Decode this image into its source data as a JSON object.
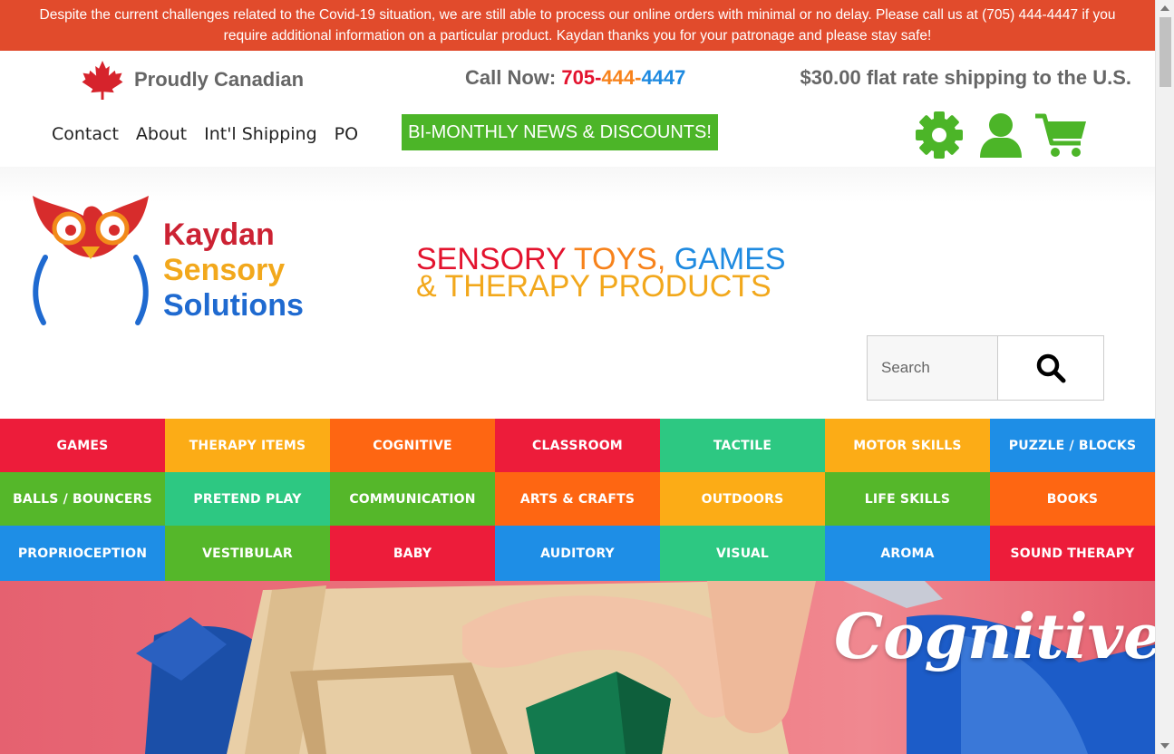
{
  "banner": {
    "line1": "Despite the current challenges related to the Covid-19 situation, we are still able to process our online orders with minimal or no delay. Please call us at (705) 444-4447 if you",
    "line2": "require additional information on a particular product. Kaydan thanks you for your patronage and please stay safe!"
  },
  "topbar": {
    "proudly_canadian": "Proudly Canadian",
    "call_label": "Call Now: ",
    "phone_part1": "705",
    "phone_sep1": "-",
    "phone_part2": "444",
    "phone_sep2": "-",
    "phone_part3": "4447",
    "shipping_text": "$30.00 flat rate shipping to the U.S.",
    "nav": [
      "Contact",
      "About",
      "Int'l Shipping",
      "PO"
    ],
    "news_button": "BI-MONTHLY NEWS & DISCOUNTS!",
    "icons": [
      "gear-icon",
      "user-icon",
      "cart-icon"
    ]
  },
  "logo": {
    "line1": "Kaydan",
    "line2": "Sensory",
    "line3": "Solutions"
  },
  "tagline": {
    "w1": "SENSORY",
    "w2": "TOYS,",
    "w3": "GAMES",
    "line2": "& THERAPY PRODUCTS"
  },
  "search": {
    "placeholder": "Search",
    "icon": "search-icon"
  },
  "categories": [
    {
      "label": "GAMES",
      "color": "#ed1c3a"
    },
    {
      "label": "THERAPY ITEMS",
      "color": "#fcac16"
    },
    {
      "label": "COGNITIVE",
      "color": "#fe6612"
    },
    {
      "label": "CLASSROOM",
      "color": "#ed1c3a"
    },
    {
      "label": "TACTILE",
      "color": "#2dc882"
    },
    {
      "label": "MOTOR SKILLS",
      "color": "#fcac16"
    },
    {
      "label": "PUZZLE / BLOCKS",
      "color": "#1e8ee6"
    },
    {
      "label": "BALLS / BOUNCERS",
      "color": "#55b72a"
    },
    {
      "label": "PRETEND PLAY",
      "color": "#2dc882"
    },
    {
      "label": "COMMUNICATION",
      "color": "#55b72a"
    },
    {
      "label": "ARTS & CRAFTS",
      "color": "#fe6612"
    },
    {
      "label": "OUTDOORS",
      "color": "#fcac16"
    },
    {
      "label": "LIFE SKILLS",
      "color": "#55b72a"
    },
    {
      "label": "BOOKS",
      "color": "#fe6612"
    },
    {
      "label": "PROPRIOCEPTION",
      "color": "#1e8ee6"
    },
    {
      "label": "VESTIBULAR",
      "color": "#55b72a"
    },
    {
      "label": "BABY",
      "color": "#ed1c3a"
    },
    {
      "label": "AUDITORY",
      "color": "#1e8ee6"
    },
    {
      "label": "VISUAL",
      "color": "#2dc882"
    },
    {
      "label": "AROMA",
      "color": "#1e8ee6"
    },
    {
      "label": "SOUND THERAPY",
      "color": "#ed1c3a"
    }
  ],
  "hero_banner": {
    "title": "Cognitive"
  },
  "colors": {
    "banner_bg": "#e14b2c",
    "accent_green": "#4cb528"
  }
}
